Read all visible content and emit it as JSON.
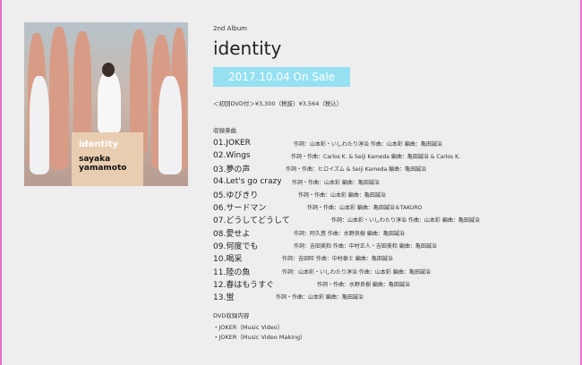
{
  "cover": {
    "title": "identity",
    "artist": "sayaka\nyamamoto"
  },
  "info": {
    "kicker": "2nd Album",
    "title": "identity",
    "on_sale": "2017.10.04 On Sale",
    "price": "＜初回DVD付＞¥3,300（税抜）¥3,564（税込）"
  },
  "tracklist": {
    "heading": "収録楽曲",
    "items": [
      {
        "name": "01.JOKER",
        "credit": "作詞：山本彩・いしわたり淳治 作曲：山本彩 編曲：亀田誠治"
      },
      {
        "name": "02.Wings",
        "credit": "作詞・作曲：Carlos K. & Seiji Kameda 編曲：亀田誠治 & Carlos K."
      },
      {
        "name": "03.夢の声",
        "credit": "作詞・作曲：ヒロイズム & Seiji Kameda 編曲：亀田誠治"
      },
      {
        "name": "04.Let's go crazy",
        "credit": "作詞・作曲：山本彩 編曲：亀田誠治"
      },
      {
        "name": "05.ゆびきり",
        "credit": "作詞・作曲：山本彩 編曲：亀田誠治"
      },
      {
        "name": "06.サードマン",
        "credit": "作詞・作曲：山本彩 編曲：亀田誠治＆TAKURO"
      },
      {
        "name": "07.どうしてどうして",
        "credit": "作詞：山本彩・いしわたり淳治 作曲：山本彩 編曲：亀田誠治"
      },
      {
        "name": "08.愛せよ",
        "credit": "作詞：阿久悠 作曲：水野良樹 編曲：亀田誠治"
      },
      {
        "name": "09.何度でも",
        "credit": "作詞：吉田美和 作曲：中村正人・吉田美和 編曲：亀田誠治"
      },
      {
        "name": "10.喝采",
        "credit": "作詞：吉田旺 作曲：中村泰士 編曲：亀田誠治"
      },
      {
        "name": "11.陸の魚",
        "credit": "作詞：山本彩・いしわたり淳治 作曲：山本彩 編曲：亀田誠治"
      },
      {
        "name": "12.春はもうすぐ",
        "credit": "作詞・作曲：水野良樹 編曲：亀田誠治"
      },
      {
        "name": "13.蛍",
        "credit": "作詞・作曲：山本彩 編曲：亀田誠治"
      }
    ]
  },
  "dvd": {
    "heading": "DVD収録内容",
    "items": [
      "・JOKER（Music Video）",
      "・JOKER（Music Video Making）"
    ]
  },
  "colors": {
    "on_sale_bg": "#95e1f2",
    "frame": "#e96fd0",
    "label_bg": "#e9cdb0"
  }
}
